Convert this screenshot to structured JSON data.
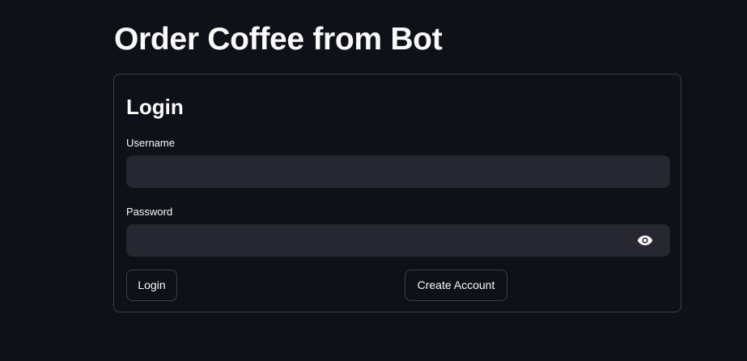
{
  "page": {
    "title": "Order Coffee from Bot"
  },
  "form": {
    "title": "Login",
    "username": {
      "label": "Username",
      "value": "",
      "placeholder": ""
    },
    "password": {
      "label": "Password",
      "value": "",
      "placeholder": "",
      "toggle_icon": "eye-icon"
    },
    "buttons": {
      "login_label": "Login",
      "create_account_label": "Create Account"
    }
  },
  "colors": {
    "background": "#0e1117",
    "input_background": "#262730",
    "text": "#fafafa",
    "border": "rgba(250,250,250,0.2)"
  }
}
